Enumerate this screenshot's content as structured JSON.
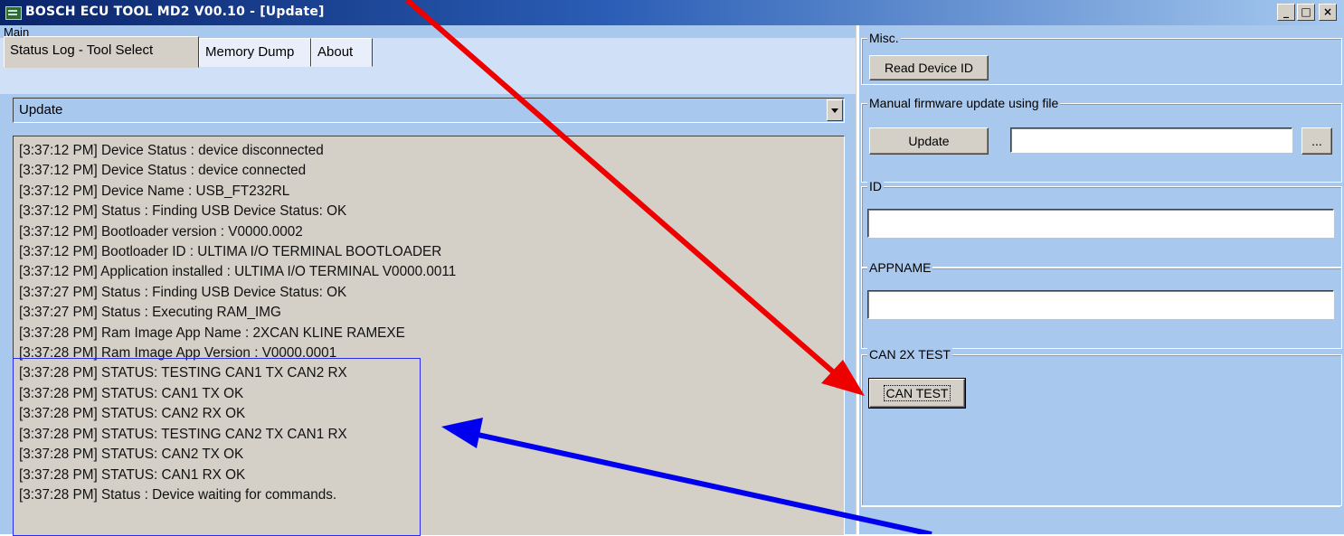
{
  "window": {
    "title": "BOSCH ECU TOOL MD2  V00.10 - [Update]",
    "minimize_glyph": "_",
    "maximize_glyph": "□",
    "close_glyph": "×",
    "icon": "app-window-icon"
  },
  "main": {
    "group_label": "Main",
    "tabs": [
      {
        "label": "Status Log - Tool Select",
        "active": true
      },
      {
        "label": "Memory Dump",
        "active": false
      },
      {
        "label": "About",
        "active": false
      }
    ],
    "tool_select": {
      "value": "Update"
    },
    "log": [
      "[3:37:12 PM] Device Status : device disconnected",
      "[3:37:12 PM] Device Status : device connected",
      "[3:37:12 PM] Device Name : USB_FT232RL",
      "[3:37:12 PM] Status : Finding USB Device Status: OK",
      "[3:37:12 PM] Bootloader version : V0000.0002",
      "[3:37:12 PM] Bootloader ID : ULTIMA I/O TERMINAL BOOTLOADER",
      "[3:37:12 PM] Application installed : ULTIMA I/O TERMINAL V0000.0011",
      "[3:37:27 PM] Status : Finding USB Device Status: OK",
      "[3:37:27 PM] Status : Executing RAM_IMG",
      "[3:37:28 PM] Ram Image App Name : 2XCAN KLINE RAMEXE",
      "[3:37:28 PM] Ram Image App Version : V0000.0001",
      "[3:37:28 PM] STATUS: TESTING CAN1 TX CAN2 RX",
      "[3:37:28 PM] STATUS: CAN1 TX OK",
      "[3:37:28 PM] STATUS: CAN2 RX OK",
      "[3:37:28 PM] STATUS: TESTING CAN2 TX CAN1 RX",
      "[3:37:28 PM] STATUS: CAN2 TX OK",
      "[3:37:28 PM] STATUS: CAN1 RX OK",
      "[3:37:28 PM] Status : Device waiting for commands."
    ]
  },
  "misc": {
    "group_label": "Misc.",
    "read_device_id_label": "Read Device ID"
  },
  "firmware": {
    "group_label": "Manual firmware update  using file",
    "update_label": "Update",
    "file_path": "",
    "browse_label": "..."
  },
  "id_group": {
    "group_label": "ID",
    "value": ""
  },
  "appname_group": {
    "group_label": "APPNAME",
    "value": ""
  },
  "can_test": {
    "group_label": "CAN 2X TEST",
    "button_label": "CAN TEST"
  },
  "colors": {
    "panel": "#a8c8ee",
    "log_background": "#d4d0c8",
    "red_arrow": "#ee0000",
    "blue_arrow": "#0000ee",
    "highlight_box": "#2a2af0"
  }
}
